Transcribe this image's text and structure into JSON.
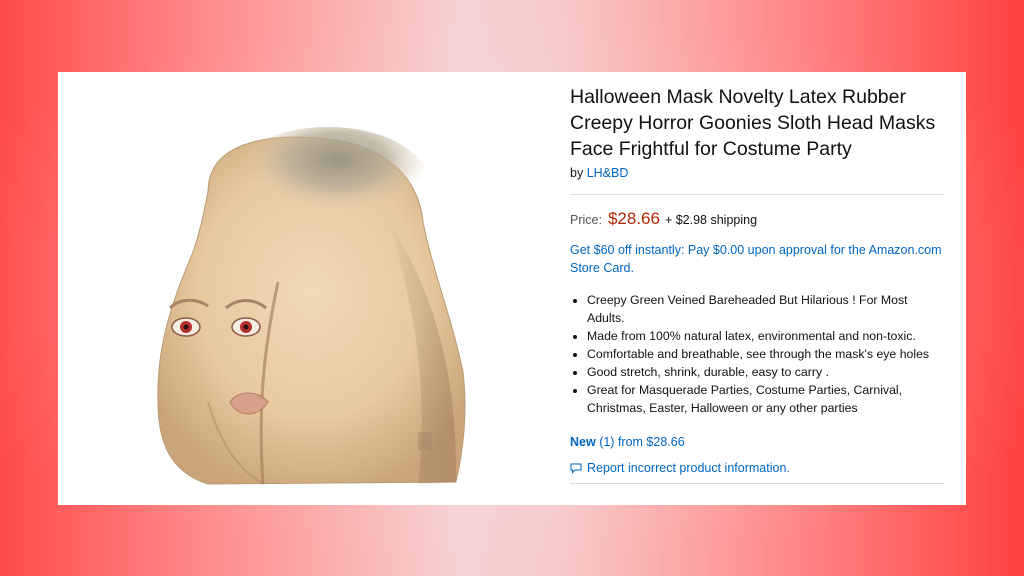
{
  "product": {
    "title": "Halloween Mask Novelty Latex Rubber Creepy Horror Goonies Sloth Head Masks Face Frightful for Costume Party",
    "by_prefix": "by",
    "brand": "LH&BD",
    "image_icon": "latex-mask-image"
  },
  "pricing": {
    "label": "Price:",
    "price": "$28.66",
    "shipping": "+ $2.98 shipping",
    "promo": "Get $60 off instantly: Pay $0.00 upon approval for the Amazon.com Store Card."
  },
  "features": [
    "Creepy Green Veined Bareheaded But Hilarious ! For Most Adults.",
    "Made from 100% natural latex, environmental and non-toxic.",
    "Comfortable and breathable, see through the mask's eye holes",
    "Good stretch, shrink, durable, easy to carry .",
    "Great for Masquerade Parties, Costume Parties, Carnival, Christmas, Easter, Halloween or any other parties"
  ],
  "offers": {
    "new_label": "New",
    "count": "(1) from $28.66"
  },
  "report": {
    "icon": "speech-bubble-icon",
    "label": "Report incorrect product information."
  },
  "colors": {
    "link": "#0066c0",
    "price": "#B12704",
    "background_edge": "#ff4040"
  }
}
